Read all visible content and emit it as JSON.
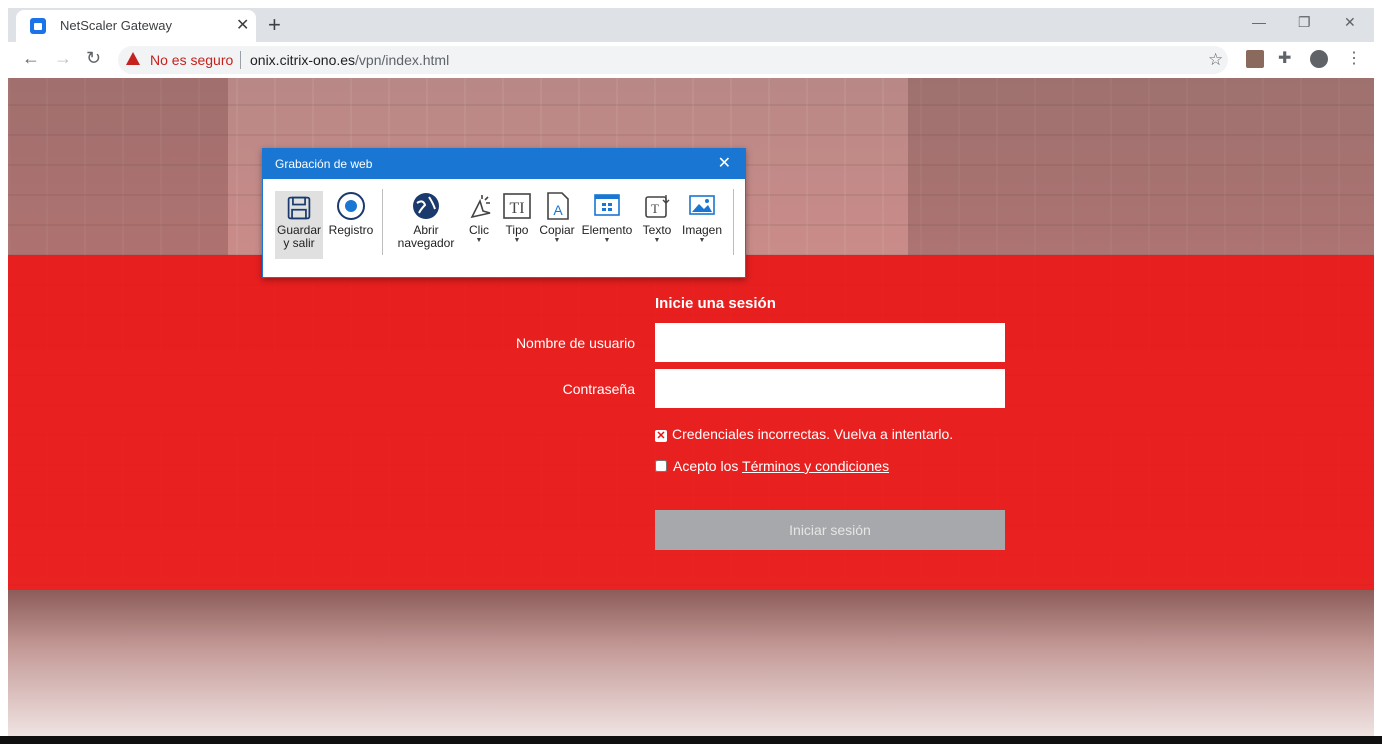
{
  "browser": {
    "tab_title": "NetScaler Gateway",
    "tab_close": "✕",
    "new_tab": "+",
    "not_secure": "No es seguro",
    "url_host": "onix.citrix-ono.es",
    "url_path": "/vpn/index.html",
    "win_minimize": "—",
    "win_restore": "❐",
    "win_close": "✕"
  },
  "login": {
    "title": "Inicie una sesión",
    "username_label": "Nombre de usuario",
    "password_label": "Contraseña",
    "username_value": "",
    "password_value": "",
    "error": "Credenciales incorrectas. Vuelva a intentarlo.",
    "terms_prefix": "Acepto los ",
    "terms_link": "Términos y condiciones",
    "submit": "Iniciar sesión"
  },
  "recorder": {
    "title": "Grabación de web",
    "close": "✕",
    "buttons": {
      "save": "Guardar y salir",
      "record": "Registro",
      "open": "Abrir navegador",
      "click": "Clic",
      "type": "Tipo",
      "copy": "Copiar",
      "element": "Elemento",
      "text": "Texto",
      "image": "Imagen"
    }
  },
  "colors": {
    "brand_red": "#e81212",
    "recorder_blue": "#1976d2",
    "disabled_button": "#a7a8ab"
  }
}
